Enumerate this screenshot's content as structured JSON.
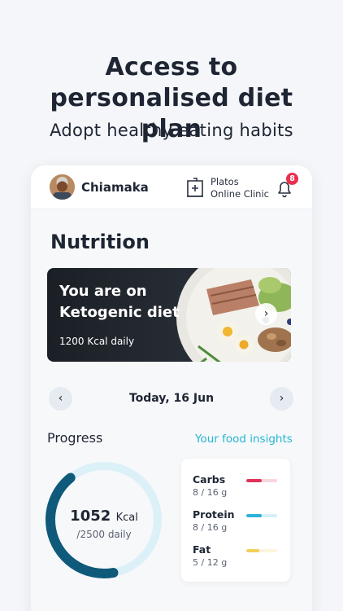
{
  "promo": {
    "headline": "Access to personalised diet plan",
    "subheadline": "Adopt healthy eating habits"
  },
  "topbar": {
    "user_name": "Chiamaka",
    "clinic_line1": "Platos",
    "clinic_line2": "Online Clinic",
    "notification_count": "8"
  },
  "nutrition": {
    "title": "Nutrition",
    "diet_card": {
      "title_line1": "You are on",
      "title_line2": "Ketogenic diet",
      "calories": "1200 Kcal daily"
    },
    "date": "Today, 16 Jun",
    "progress_label": "Progress",
    "insights_link": "Your food insights",
    "calories_consumed": "1052",
    "calories_unit": "Kcal",
    "calories_daily": "/2500 daily",
    "calories_progress": 0.42,
    "macros": [
      {
        "name": "Carbs",
        "amount": "8 / 16 g",
        "progress": 0.5,
        "color": "#e0335a"
      },
      {
        "name": "Protein",
        "amount": "8 / 16 g",
        "progress": 0.5,
        "color": "#2bb3d9"
      },
      {
        "name": "Fat",
        "amount": "5 / 12 g",
        "progress": 0.42,
        "color": "#f2cf5b"
      }
    ]
  },
  "colors": {
    "accent": "#25b6d2",
    "ring_fill": "#0f5a7a",
    "ring_track": "#dcf0f8",
    "badge": "#e8304e"
  }
}
